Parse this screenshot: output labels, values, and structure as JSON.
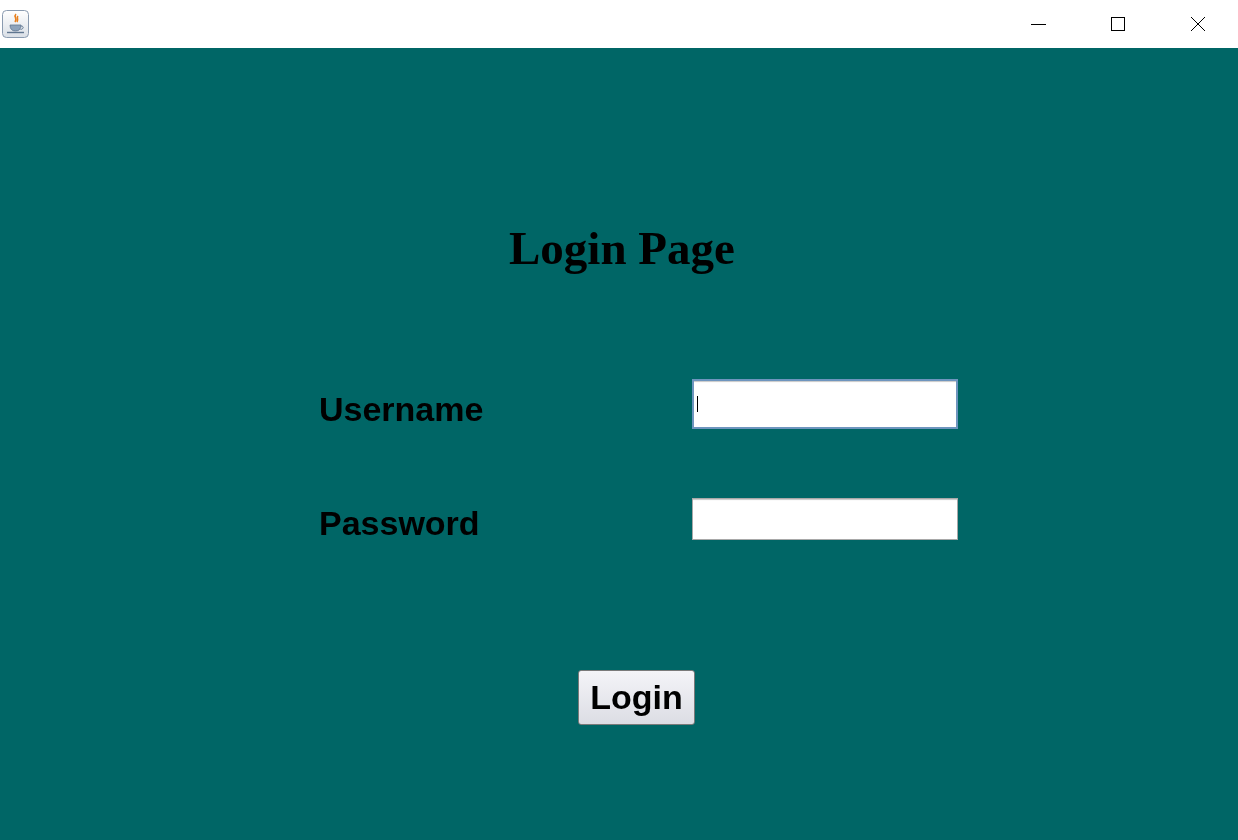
{
  "heading": "Login Page",
  "form": {
    "fields": [
      {
        "label": "Username",
        "focused": true
      },
      {
        "label": "Password",
        "focused": false
      }
    ]
  },
  "button": {
    "label": "Login"
  }
}
